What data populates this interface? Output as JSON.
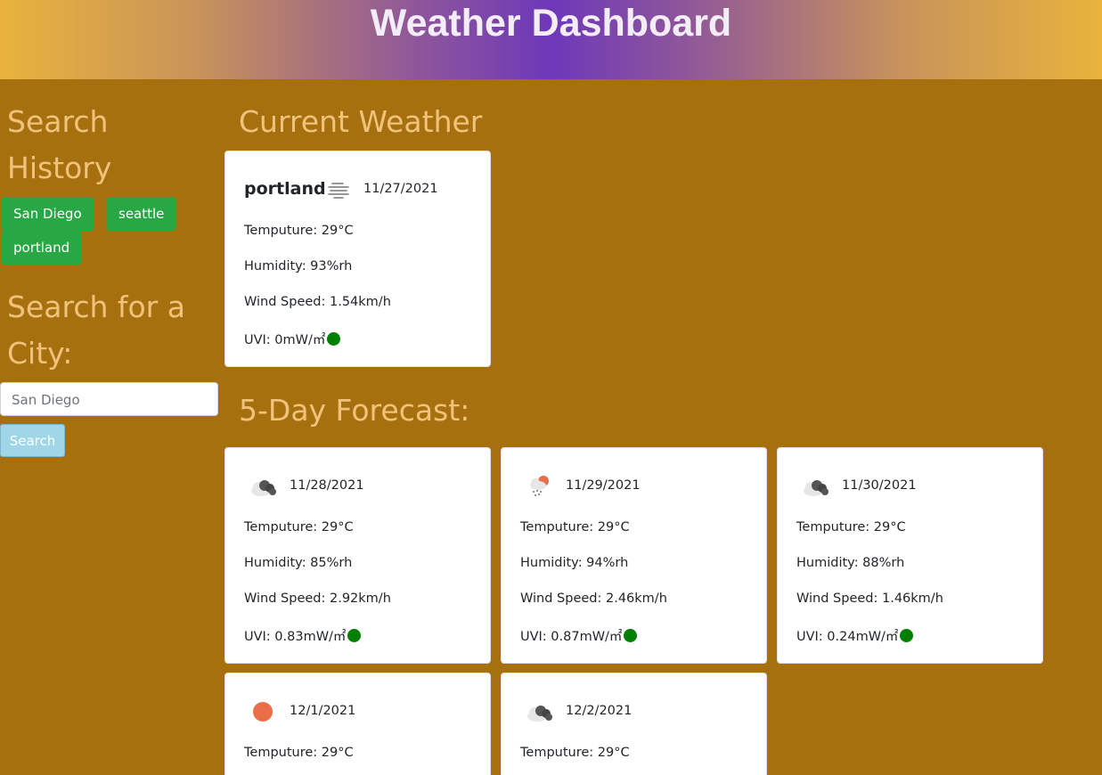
{
  "header": {
    "title": "Weather Dashboard"
  },
  "sidebar": {
    "history_title_line1": "Search",
    "history_title_line2": "History",
    "history": [
      "San Diego",
      "seattle",
      "portland"
    ],
    "search_title_line1": "Search for a",
    "search_title_line2": "City:",
    "input_placeholder": "San Diego",
    "search_button": "Search"
  },
  "current": {
    "section_title": "Current Weather",
    "city": "portland",
    "icon": "mist-icon",
    "date": "11/27/2021",
    "temp": "Temputure: 29°C",
    "humidity": "Humidity: 93%rh",
    "wind": "Wind Speed: 1.54km/h",
    "uvi": "UVI: 0mW/㎡",
    "uvi_color": "#008000"
  },
  "forecast": {
    "section_title": "5-Day Forecast:",
    "days": [
      {
        "icon": "broken-clouds-icon",
        "date": "11/28/2021",
        "temp": "Temputure: 29°C",
        "humidity": "Humidity: 85%rh",
        "wind": "Wind Speed: 2.92km/h",
        "uvi": "UVI: 0.83mW/㎡"
      },
      {
        "icon": "rain-sun-icon",
        "date": "11/29/2021",
        "temp": "Temputure: 29°C",
        "humidity": "Humidity: 94%rh",
        "wind": "Wind Speed: 2.46km/h",
        "uvi": "UVI: 0.87mW/㎡"
      },
      {
        "icon": "broken-clouds-icon",
        "date": "11/30/2021",
        "temp": "Temputure: 29°C",
        "humidity": "Humidity: 88%rh",
        "wind": "Wind Speed: 1.46km/h",
        "uvi": "UVI: 0.24mW/㎡"
      },
      {
        "icon": "clear-sun-icon",
        "date": "12/1/2021",
        "temp": "Temputure: 29°C"
      },
      {
        "icon": "broken-clouds-icon",
        "date": "12/2/2021",
        "temp": "Temputure: 29°C"
      }
    ]
  },
  "colors": {
    "background": "#a7700f",
    "heading": "#f1c27c",
    "history_button": "#28a745",
    "search_button": "#9fd6e8",
    "uvi_good": "#008000"
  }
}
